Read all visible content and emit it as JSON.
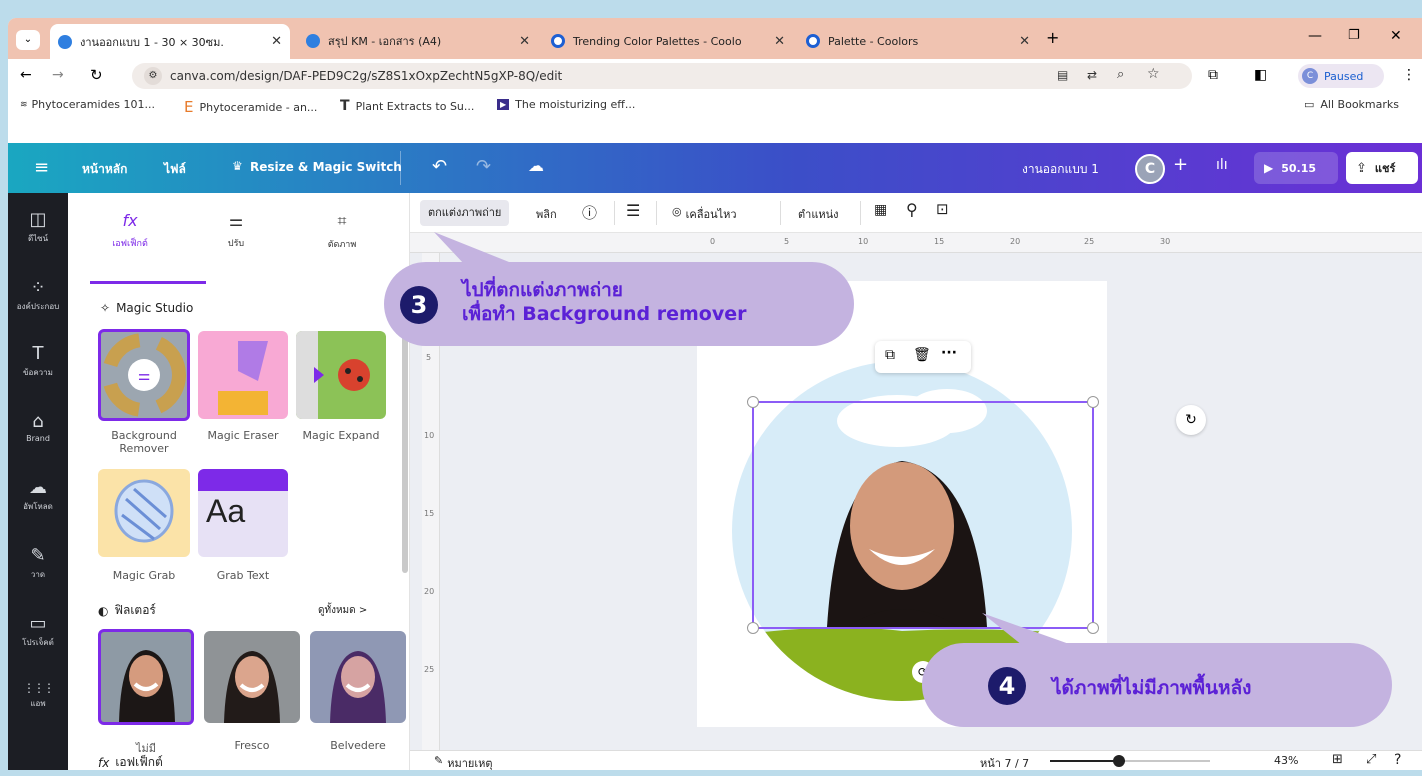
{
  "browser": {
    "tabs": [
      {
        "title": "งานออกแบบ 1 - 30 × 30ซม.",
        "active": true
      },
      {
        "title": "สรุป KM - เอกสาร (A4)",
        "active": false
      },
      {
        "title": "Trending Color Palettes - Coolo",
        "active": false
      },
      {
        "title": "Palette - Coolors",
        "active": false
      }
    ],
    "new_tab": "+",
    "url": "canva.com/design/DAF-PED9C2g/sZ8S1xOxpZechtN5gXP-8Q/edit",
    "profile_status": "Paused",
    "profile_initial": "C",
    "bookmarks": [
      "Phytoceramides 101...",
      "Phytoceramide - an...",
      "Plant Extracts to Su...",
      "The moisturizing eff..."
    ],
    "all_bookmarks": "All Bookmarks"
  },
  "canva_header": {
    "home": "หน้าหลัก",
    "file": "ไฟล์",
    "resize": "Resize & Magic Switch",
    "design_title": "งานออกแบบ 1",
    "avatar": "C",
    "timer": "50.15",
    "share": "แชร์"
  },
  "rail": [
    {
      "icon": "template-icon",
      "glyph": "◫",
      "label": "ดีไซน์"
    },
    {
      "icon": "elements-icon",
      "glyph": "⁘",
      "label": "องค์ประกอบ"
    },
    {
      "icon": "text-icon",
      "glyph": "T",
      "label": "ข้อความ"
    },
    {
      "icon": "brand-icon",
      "glyph": "⌂",
      "label": "Brand"
    },
    {
      "icon": "upload-icon",
      "glyph": "☁",
      "label": "อัพโหลด"
    },
    {
      "icon": "draw-icon",
      "glyph": "✎",
      "label": "วาด"
    },
    {
      "icon": "projects-icon",
      "glyph": "▭",
      "label": "โปรเจ็คต์"
    },
    {
      "icon": "apps-icon",
      "glyph": "⋮⋮⋮",
      "label": "แอพ"
    }
  ],
  "panel": {
    "tabs": [
      {
        "glyph": "fx",
        "label": "เอฟเฟ็กต์"
      },
      {
        "glyph": "⚌",
        "label": "ปรับ"
      },
      {
        "glyph": "⌗",
        "label": "ตัดภาพ"
      }
    ],
    "magic_studio": "Magic Studio",
    "tools": [
      "Background Remover",
      "Magic Eraser",
      "Magic Expand",
      "Magic Grab",
      "Grab Text"
    ],
    "filters_title": "ฟิลเตอร์",
    "see_all": "ดูทั้งหมด >",
    "filters": [
      "ไม่มี",
      "Fresco",
      "Belvedere"
    ],
    "effects_title": "เอฟเฟ็กต์",
    "grab_text_glyph": "Aa"
  },
  "toolbar": {
    "edit_photo": "ตกแต่งภาพถ่าย",
    "flip": "พลิก",
    "animate": "เคลื่อนไหว",
    "position": "ตำแหน่ง"
  },
  "ruler_ticks": [
    "0",
    "5",
    "10",
    "15",
    "20",
    "25",
    "30"
  ],
  "ruler_ticks_v": [
    "5",
    "10",
    "15",
    "20",
    "25"
  ],
  "callouts": {
    "step3_num": "3",
    "step3_line1": "ไปที่ตกแต่งภาพถ่าย",
    "step3_line2": "เพื่อทำ Background remover",
    "step4_num": "4",
    "step4_text": "ได้ภาพที่ไม่มีภาพพื้นหลัง"
  },
  "status": {
    "notes": "หมายเหตุ",
    "page": "หน้า 7 / 7",
    "zoom": "43%",
    "zoom_level": 0.43
  },
  "colors": {
    "callout_bg": "#c4b3e0",
    "callout_text": "#5b21d6",
    "badge": "#1d1b6b",
    "selection": "#8b5cf6"
  }
}
